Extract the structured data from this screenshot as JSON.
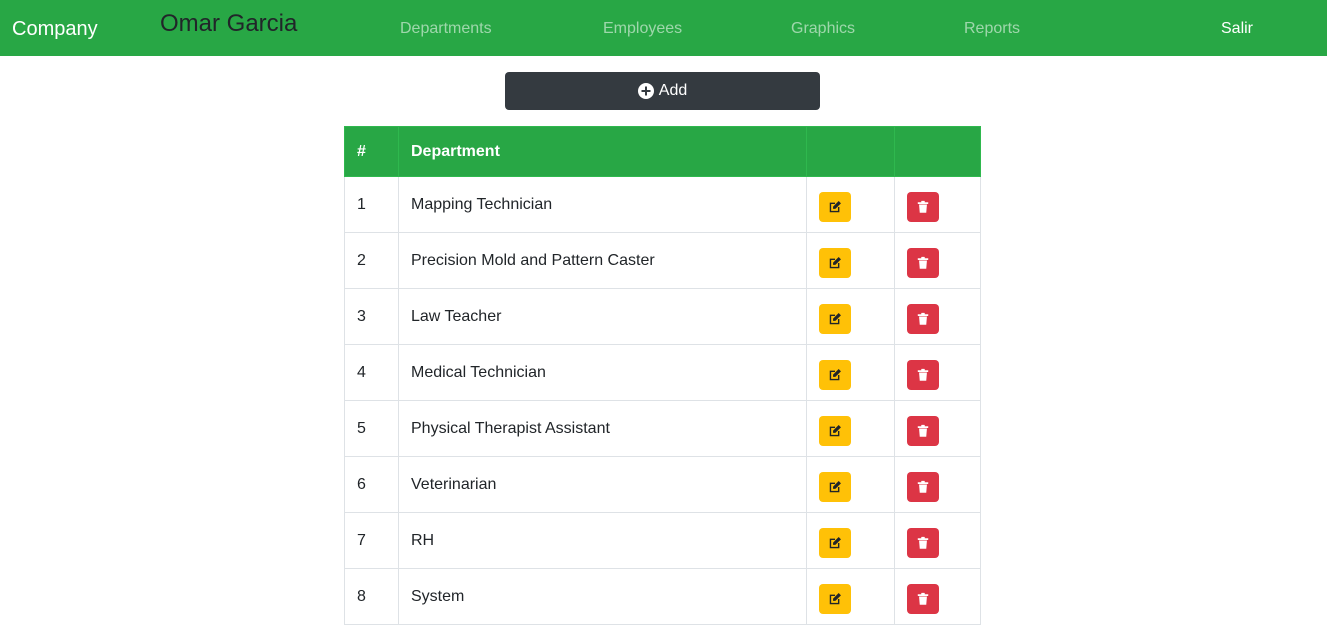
{
  "navbar": {
    "brand": "Company",
    "username": "Omar Garcia",
    "links": [
      "Departments",
      "Employees",
      "Graphics",
      "Reports"
    ],
    "logout": "Salir"
  },
  "toolbar": {
    "add_label": "Add"
  },
  "table": {
    "headers": [
      "#",
      "Department",
      "",
      ""
    ],
    "rows": [
      {
        "num": "1",
        "name": "Mapping Technician"
      },
      {
        "num": "2",
        "name": "Precision Mold and Pattern Caster"
      },
      {
        "num": "3",
        "name": "Law Teacher"
      },
      {
        "num": "4",
        "name": "Medical Technician"
      },
      {
        "num": "5",
        "name": "Physical Therapist Assistant"
      },
      {
        "num": "6",
        "name": "Veterinarian"
      },
      {
        "num": "7",
        "name": "RH"
      },
      {
        "num": "8",
        "name": "System"
      }
    ],
    "row_actions": [
      "edit-icon",
      "trash-icon"
    ]
  },
  "colors": {
    "navbar": "#28a745",
    "add_button": "#343a40",
    "edit_button": "#ffc107",
    "delete_button": "#dc3545"
  }
}
